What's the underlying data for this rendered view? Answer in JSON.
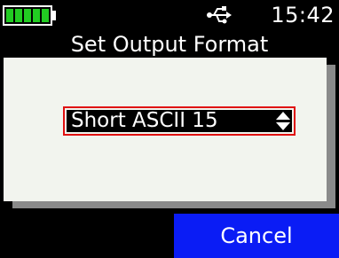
{
  "status_bar": {
    "battery_icon": "battery-full-icon",
    "battery_level": 1.0,
    "usb_icon": "usb-icon",
    "time": "15:42"
  },
  "page": {
    "title": "Set Output Format"
  },
  "dialog": {
    "select": {
      "value": "Short ASCII 15",
      "icon": "up-down-spinner-icon"
    }
  },
  "footer": {
    "cancel_label": "Cancel"
  },
  "colors": {
    "background": "#000000",
    "battery": "#22cc22",
    "dialog": "#f2f4ee",
    "focus_border": "#e01010",
    "cancel_button": "#0a1cf5"
  }
}
